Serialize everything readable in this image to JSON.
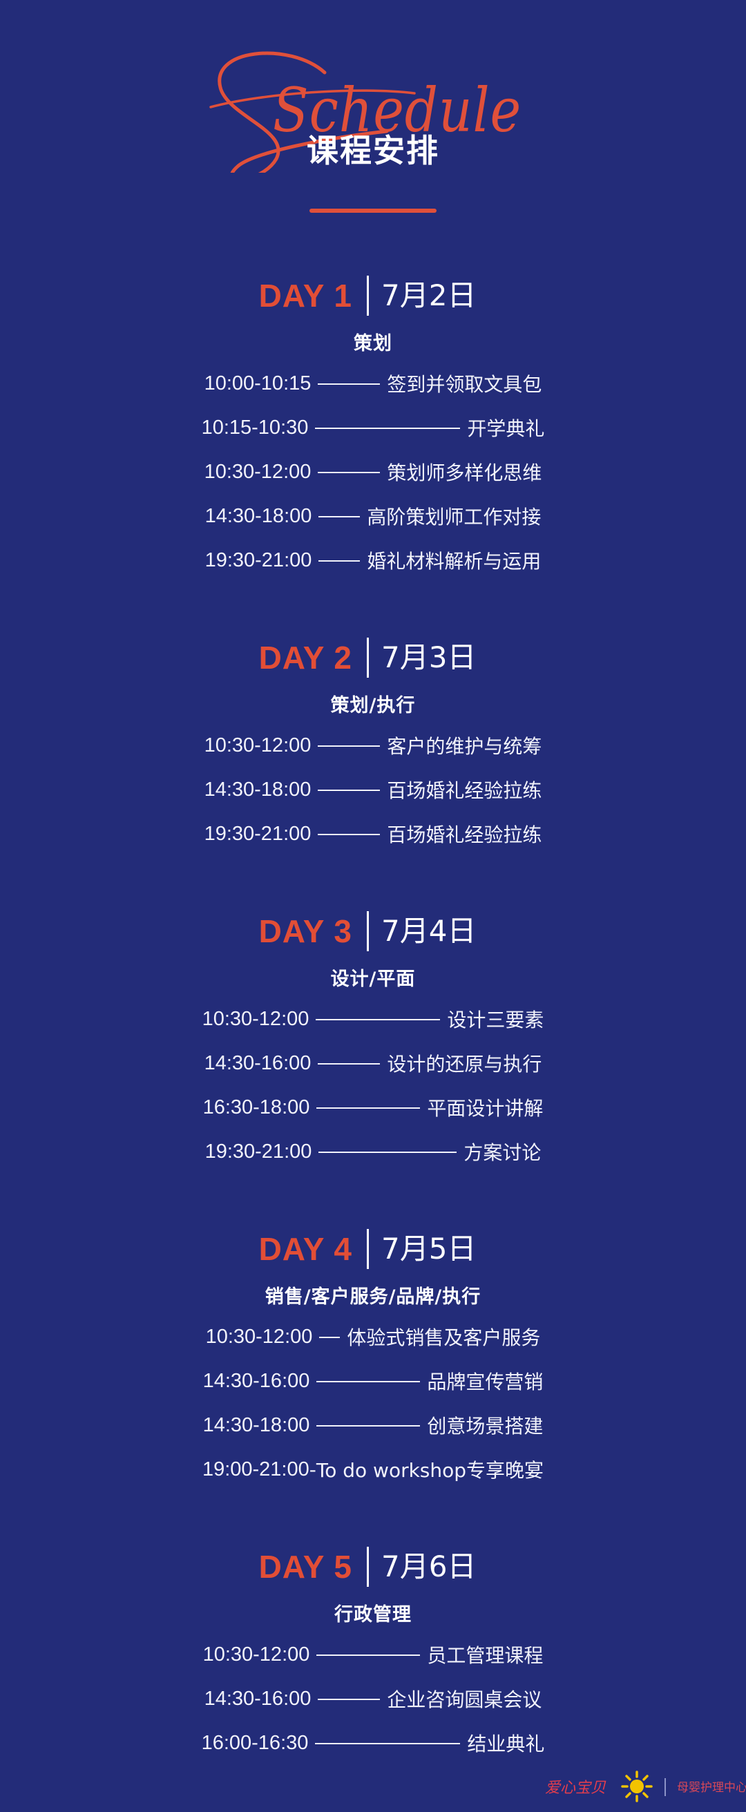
{
  "header": {
    "script_title": "Schedule",
    "cn_title": "课程安排",
    "accent_color": "#e24e36",
    "background_color": "#232c79"
  },
  "days": [
    {
      "label": "DAY 1",
      "date": "7月2日",
      "topic": "策划",
      "items": [
        {
          "time": "10:00-10:15",
          "title": "签到并领取文具包"
        },
        {
          "time": "10:15-10:30",
          "title": "开学典礼"
        },
        {
          "time": "10:30-12:00",
          "title": "策划师多样化思维"
        },
        {
          "time": "14:30-18:00",
          "title": "高阶策划师工作对接"
        },
        {
          "time": "19:30-21:00",
          "title": "婚礼材料解析与运用"
        }
      ]
    },
    {
      "label": "DAY 2",
      "date": "7月3日",
      "topic": "策划/执行",
      "items": [
        {
          "time": "10:30-12:00",
          "title": "客户的维护与统筹"
        },
        {
          "time": "14:30-18:00",
          "title": "百场婚礼经验拉练"
        },
        {
          "time": "19:30-21:00",
          "title": "百场婚礼经验拉练"
        }
      ]
    },
    {
      "label": "DAY 3",
      "date": "7月4日",
      "topic": "设计/平面",
      "items": [
        {
          "time": "10:30-12:00",
          "title": "设计三要素"
        },
        {
          "time": "14:30-16:00",
          "title": "设计的还原与执行"
        },
        {
          "time": "16:30-18:00",
          "title": "平面设计讲解"
        },
        {
          "time": "19:30-21:00",
          "title": "方案讨论"
        }
      ]
    },
    {
      "label": "DAY 4",
      "date": "7月5日",
      "topic": "销售/客户服务/品牌/执行",
      "items": [
        {
          "time": "10:30-12:00",
          "title": "体验式销售及客户服务"
        },
        {
          "time": "14:30-16:00",
          "title": "品牌宣传营销"
        },
        {
          "time": "14:30-18:00",
          "title": "创意场景搭建"
        },
        {
          "time": "19:00-21:00",
          "title": "To do workshop专享晚宴"
        }
      ]
    },
    {
      "label": "DAY 5",
      "date": "7月6日",
      "topic": "行政管理",
      "items": [
        {
          "time": "10:30-12:00",
          "title": "员工管理课程"
        },
        {
          "time": "14:30-16:00",
          "title": "企业咨询圆桌会议"
        },
        {
          "time": "16:00-16:30",
          "title": "结业典礼"
        }
      ]
    }
  ],
  "footer": {
    "brand_1": "爱心宝贝",
    "brand_2": "母婴护理中心",
    "logo_icon": "sun-logo-icon"
  }
}
